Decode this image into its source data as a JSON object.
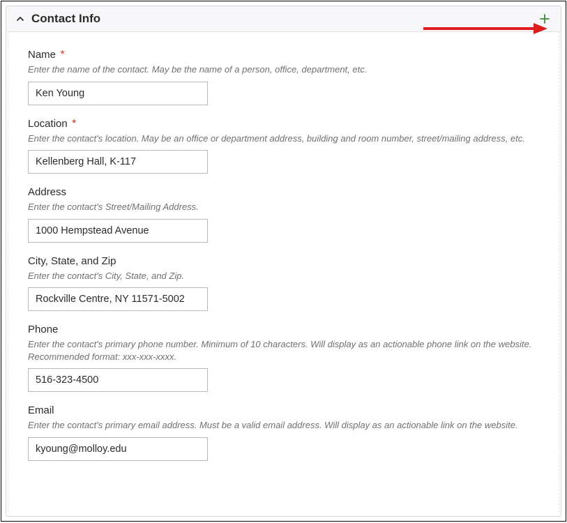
{
  "panel": {
    "title": "Contact Info"
  },
  "fields": {
    "name": {
      "label": "Name",
      "required": true,
      "hint": "Enter the name of the contact. May be the name of a person, office, department, etc.",
      "value": "Ken Young"
    },
    "location": {
      "label": "Location",
      "required": true,
      "hint": "Enter the contact's location. May be an office or department address, building and room number, street/mailing address, etc.",
      "value": "Kellenberg Hall, K-117"
    },
    "address": {
      "label": "Address",
      "required": false,
      "hint": "Enter the contact's Street/Mailing Address.",
      "value": "1000 Hempstead Avenue"
    },
    "city_state_zip": {
      "label": "City, State, and Zip",
      "required": false,
      "hint": "Enter the contact's City, State, and Zip.",
      "value": "Rockville Centre, NY 11571-5002"
    },
    "phone": {
      "label": "Phone",
      "required": false,
      "hint": "Enter the contact's primary phone number. Minimum of 10 characters. Will display as an actionable phone link on the website. Recommended format: xxx-xxx-xxxx.",
      "value": "516-323-4500"
    },
    "email": {
      "label": "Email",
      "required": false,
      "hint": "Enter the contact's primary email address. Must be a valid email address. Will display as an actionable link on the website.",
      "value": "kyoung@molloy.edu"
    }
  },
  "required_marker": "*",
  "annotation": {
    "arrow_color": "#e01b1b"
  }
}
